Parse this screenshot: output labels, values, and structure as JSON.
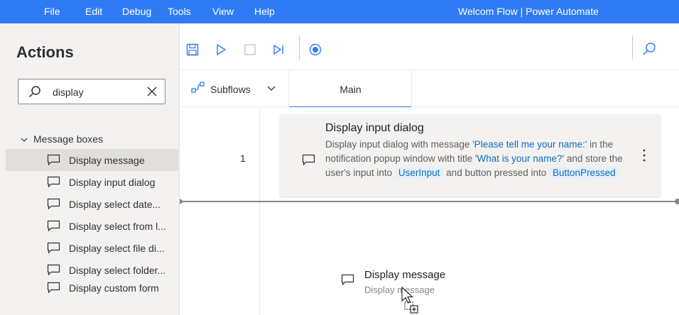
{
  "menu": {
    "items": [
      "File",
      "Edit",
      "Debug",
      "Tools",
      "View",
      "Help"
    ],
    "app_title": "Welcom Flow | Power Automate"
  },
  "actions_pane": {
    "title": "Actions",
    "search": {
      "value": "display"
    },
    "group": {
      "label": "Message boxes",
      "items": [
        {
          "label": "Display message",
          "selected": true
        },
        {
          "label": "Display input dialog"
        },
        {
          "label": "Display select date..."
        },
        {
          "label": "Display select from l..."
        },
        {
          "label": "Display select file di..."
        },
        {
          "label": "Display select folder..."
        },
        {
          "label": "Display custom form"
        }
      ]
    }
  },
  "tabs": {
    "subflows_label": "Subflows",
    "main_label": "Main"
  },
  "canvas": {
    "step": {
      "number": "1",
      "title": "Display input dialog",
      "desc_1": "Display input dialog with message ",
      "message": "'Please tell me your name:'",
      "desc_2": " in the notification popup window with title ",
      "window_title": "'What is your name?'",
      "desc_3": " and store the user's input into ",
      "var_input": "UserInput",
      "desc_4": " and button pressed into ",
      "var_button": "ButtonPressed"
    },
    "drag_ghost": {
      "title": "Display message",
      "subtitle": "Display message"
    }
  },
  "colors": {
    "accent": "#2f7bf5",
    "link": "#0f6cbd"
  }
}
